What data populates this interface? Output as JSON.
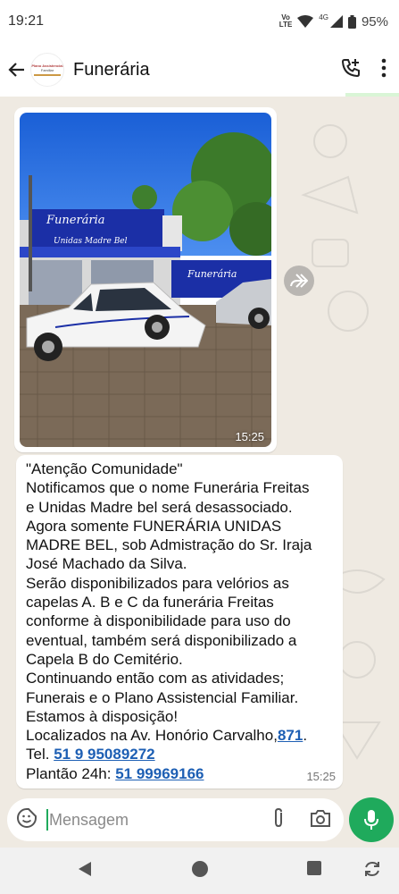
{
  "status_bar": {
    "time": "19:21",
    "volte_line1": "Vo",
    "volte_line2": "LTE",
    "network": "4G",
    "battery": "95%"
  },
  "header": {
    "title": "Funerária",
    "avatar_line1": "Plano Assistencial",
    "avatar_line2": "Familiar"
  },
  "image_message": {
    "time": "15:25",
    "sign_text_1": "Funerária",
    "sign_text_2": "Unidas Madre Bel",
    "sign_text_3": "Funerária"
  },
  "text_message": {
    "lines": [
      "\"Atenção Comunidade\"",
      "Notificamos que o nome  Funerária Freitas",
      "e Unidas Madre bel será desassociado.",
      "Agora somente FUNERÁRIA UNIDAS",
      "MADRE BEL, sob Admistração do Sr. Iraja",
      "José Machado da Silva.",
      "Serão disponibilizados para velórios as",
      "capelas A. B e C  da funerária Freitas",
      "conforme à disponibilidade para uso do",
      "eventual, também será disponibilizado a",
      "Capela B do Cemitério.",
      "Continuando então com as atividades;",
      "Funerais e o Plano Assistencial Familiar.",
      "Estamos à disposição!"
    ],
    "address_prefix": "Localizados na Av. Honório Carvalho,",
    "address_number": "871",
    "address_suffix": ".",
    "tel_label": "Tel. ",
    "tel_number": "51 9 95089272",
    "plantao_label": "Plantão 24h: ",
    "plantao_number": "51 99969166",
    "time": "15:25"
  },
  "input": {
    "placeholder": "Mensagem"
  },
  "colors": {
    "accent_green": "#1faa5c",
    "link_blue": "#1d5fb4",
    "chat_bg": "#efeae2"
  }
}
